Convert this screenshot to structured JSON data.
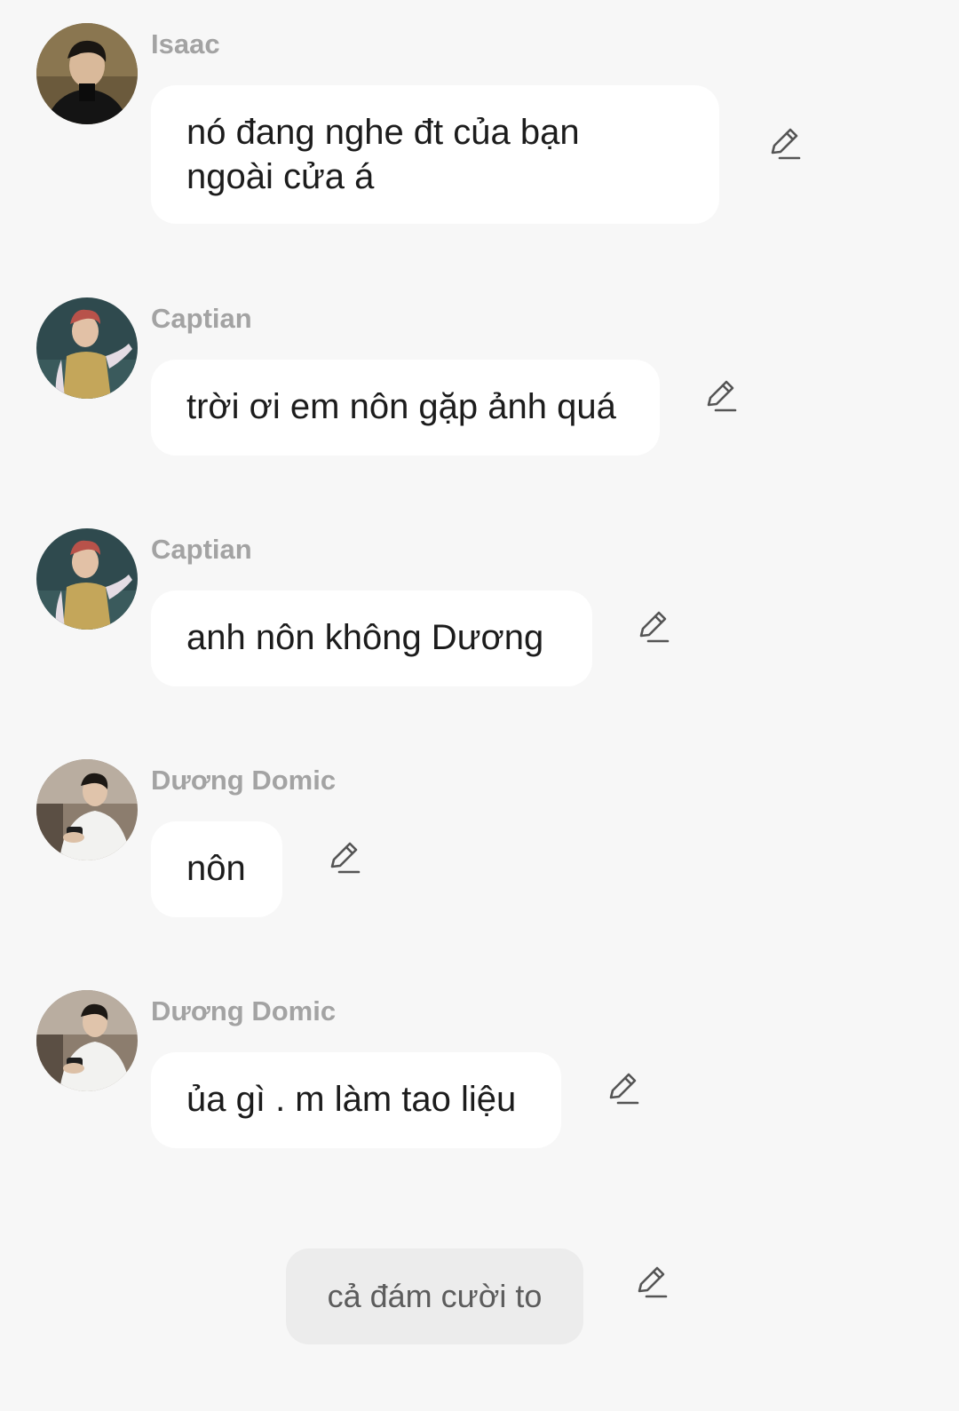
{
  "messages": [
    {
      "sender": "Isaac",
      "avatar": "avatar-isaac",
      "text_lines": [
        "nó đang nghe đt của bạn",
        "ngoài cửa á"
      ]
    },
    {
      "sender": "Captian",
      "avatar": "avatar-captian",
      "text_lines": [
        "trời ơi em nôn gặp ảnh quá"
      ]
    },
    {
      "sender": "Captian",
      "avatar": "avatar-captian",
      "text_lines": [
        "anh nôn không Dương"
      ]
    },
    {
      "sender": "Dương Domic",
      "avatar": "avatar-duong-domic",
      "text_lines": [
        "nôn"
      ]
    },
    {
      "sender": "Dương Domic",
      "avatar": "avatar-duong-domic",
      "text_lines": [
        "ủa gì . m làm tao liệu"
      ]
    }
  ],
  "narration": {
    "text": "cả đám cười to"
  },
  "icons": {
    "edit": "pencil-edit-icon"
  },
  "colors": {
    "background": "#f7f7f7",
    "bubble": "#ffffff",
    "narration_bubble": "#ececec",
    "sender_name": "#a3a3a3",
    "message_text": "#1c1c1c",
    "icon": "#555555"
  }
}
